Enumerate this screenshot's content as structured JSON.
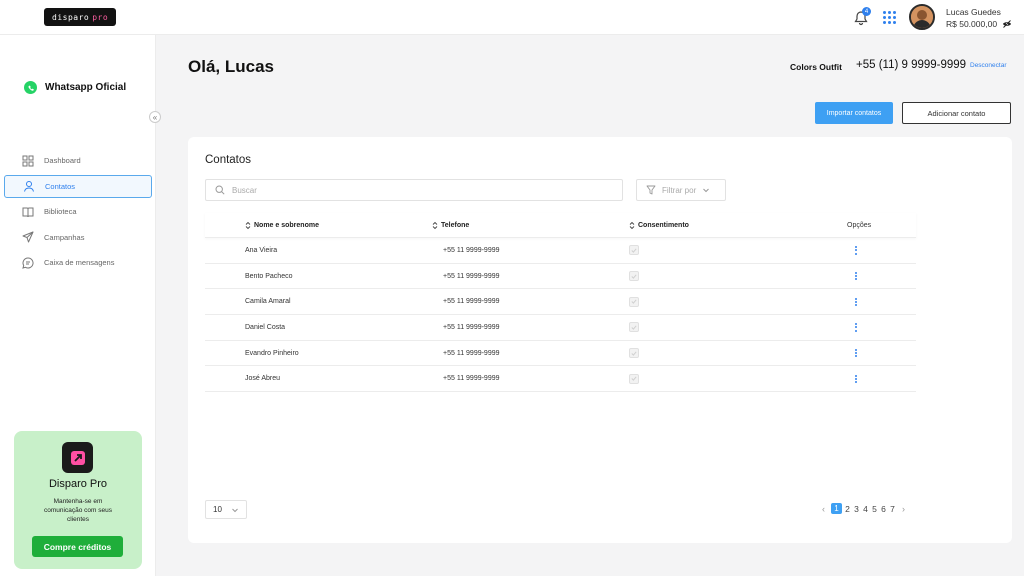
{
  "header": {
    "logo_text": "disparo",
    "logo_accent": "pro",
    "notification_count": "4",
    "user_name": "Lucas Guedes",
    "user_balance": "R$ 50.000,00"
  },
  "sidebar": {
    "channel_label": "Whatsapp Oficial",
    "items": [
      {
        "label": "Dashboard",
        "icon": "grid-icon",
        "active": false
      },
      {
        "label": "Contatos",
        "icon": "user-icon",
        "active": true
      },
      {
        "label": "Biblioteca",
        "icon": "book-icon",
        "active": false
      },
      {
        "label": "Campanhas",
        "icon": "send-icon",
        "active": false
      },
      {
        "label": "Caixa de mensagens",
        "icon": "chat-icon",
        "active": false
      }
    ],
    "promo": {
      "title": "Disparo Pro",
      "text": "Mantenha-se em comunicação com seus clientes",
      "button": "Compre créditos"
    }
  },
  "main": {
    "greeting": "Olá, Lucas",
    "company": "Colors Outfit",
    "phone": "+55 (11) 9 9999-9999",
    "disconnect": "Desconectar",
    "import_button": "Importar contatos",
    "add_button": "Adicionar contato"
  },
  "contacts": {
    "title": "Contatos",
    "search_placeholder": "Buscar",
    "filter_label": "Filtrar por",
    "columns": {
      "name": "Nome e sobrenome",
      "phone": "Telefone",
      "consent": "Consentimento",
      "options": "Opções"
    },
    "rows": [
      {
        "name": "Ana Vieira",
        "phone": "+55 11 9999-9999"
      },
      {
        "name": "Bento Pacheco",
        "phone": "+55 11 9999-9999"
      },
      {
        "name": "Camila Amaral",
        "phone": "+55 11 9999-9999"
      },
      {
        "name": "Daniel Costa",
        "phone": "+55 11 9999-9999"
      },
      {
        "name": "Evandro Pinheiro",
        "phone": "+55 11 9999-9999"
      },
      {
        "name": "José Abreu",
        "phone": "+55 11 9999-9999"
      }
    ],
    "per_page": "10",
    "pages": [
      "1",
      "2",
      "3",
      "4",
      "5",
      "6",
      "7"
    ],
    "current_page": "1"
  },
  "colors": {
    "accent": "#3ea0f3",
    "promo_bg": "#c8f0c9",
    "promo_button": "#1fae3a"
  }
}
